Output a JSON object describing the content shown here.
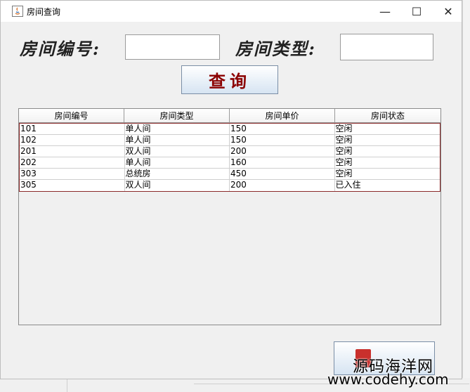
{
  "window": {
    "title": "房间查询",
    "controls": {
      "minimize": "—",
      "maximize": "☐",
      "close": "✕"
    }
  },
  "form": {
    "room_number_label": "房间编号:",
    "room_type_label": "房间类型:",
    "room_number_value": "",
    "room_type_value": ""
  },
  "query_button": {
    "label": "查询"
  },
  "table": {
    "columns": [
      "房间编号",
      "房间类型",
      "房间单价",
      "房间状态"
    ],
    "rows": [
      [
        "101",
        "单人间",
        "150",
        "空闲"
      ],
      [
        "102",
        "单人间",
        "150",
        "空闲"
      ],
      [
        "201",
        "双人间",
        "200",
        "空闲"
      ],
      [
        "202",
        "单人间",
        "160",
        "空闲"
      ],
      [
        "303",
        "总统房",
        "450",
        "空闲"
      ],
      [
        "305",
        "双人间",
        "200",
        "已入住"
      ]
    ]
  },
  "watermark": {
    "line1": "源码海洋网",
    "line2": "www.codehy.com"
  },
  "colors": {
    "selection_border": "#8b2a2a",
    "query_text": "#8b0000",
    "window_bg": "#f0f0f0"
  }
}
